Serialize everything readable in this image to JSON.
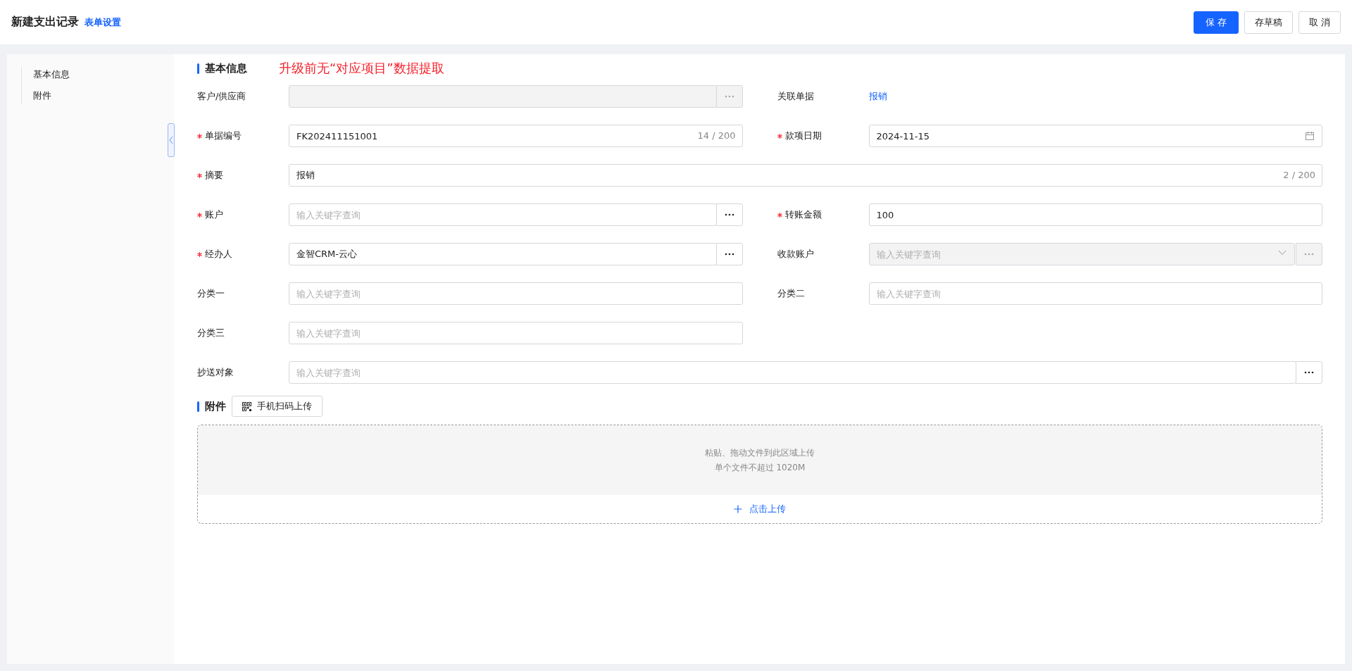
{
  "header": {
    "title": "新建支出记录",
    "settings_link": "表单设置",
    "buttons": [
      {
        "label": "保 存",
        "kind": "primary"
      },
      {
        "label": "存草稿",
        "kind": "default"
      },
      {
        "label": "取 消",
        "kind": "default"
      }
    ]
  },
  "sidebar": {
    "items": [
      {
        "label": "基本信息",
        "selected": false
      },
      {
        "label": "附件",
        "selected": false
      }
    ]
  },
  "basic": {
    "title": "基本信息",
    "note": "升级前无“对应项目”数据提取",
    "rows": [
      [
        {
          "label": "客户/供应商",
          "required": false,
          "kind": "lookup",
          "disabled": true
        },
        {
          "label": "关联单据",
          "required": false,
          "kind": "link",
          "value": "报销"
        }
      ],
      [
        {
          "label": "单据编号",
          "required": true,
          "kind": "text",
          "value": "FK202411151001",
          "counter": "14 / 200"
        },
        {
          "label": "款项日期",
          "required": true,
          "kind": "date",
          "value": "2024-11-15"
        }
      ],
      [
        {
          "label": "摘要",
          "required": true,
          "kind": "text",
          "wide": true,
          "value": "报销",
          "counter": "2 / 200"
        }
      ],
      [
        {
          "label": "账户",
          "required": true,
          "kind": "lookup",
          "disabled": false,
          "placeholder": "输入关键字查询"
        },
        {
          "label": "转账金额",
          "required": true,
          "kind": "text",
          "value": "100"
        }
      ],
      [
        {
          "label": "经办人",
          "required": true,
          "kind": "lookup",
          "disabled": false,
          "value": "金智CRM-云心"
        },
        {
          "label": "收款账户",
          "required": false,
          "kind": "select-lookup",
          "disabled": true,
          "placeholder": "输入关键字查询"
        }
      ],
      [
        {
          "label": "分类一",
          "required": false,
          "kind": "text",
          "placeholder": "输入关键字查询"
        },
        {
          "label": "分类二",
          "required": false,
          "kind": "text",
          "placeholder": "输入关键字查询"
        }
      ],
      [
        {
          "label": "分类三",
          "required": false,
          "kind": "text",
          "placeholder": "输入关键字查询"
        }
      ],
      [
        {
          "label": "抄送对象",
          "required": false,
          "kind": "lookup",
          "wide": true,
          "disabled": false,
          "placeholder": "输入关键字查询"
        }
      ]
    ]
  },
  "attachments": {
    "title": "附件",
    "scan_button": "手机扫码上传",
    "drop_hint": "粘贴、拖动文件到此区域上传",
    "size_hint": "单个文件不超过 1020M",
    "upload_link": "点击上传"
  }
}
